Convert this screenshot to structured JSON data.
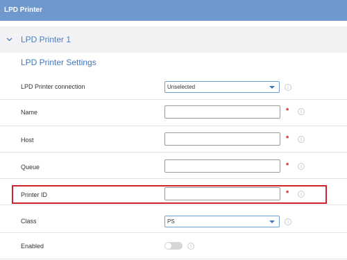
{
  "header": {
    "title": "LPD Printer"
  },
  "section": {
    "title": "LPD Printer 1",
    "subtitle": "LPD Printer Settings"
  },
  "fields": {
    "connection": {
      "label": "LPD Printer connection",
      "value": "Unselected"
    },
    "name": {
      "label": "Name",
      "value": "",
      "required": "*"
    },
    "host": {
      "label": "Host",
      "value": "",
      "required": "*"
    },
    "queue": {
      "label": "Queue",
      "value": "",
      "required": "*"
    },
    "printer_id": {
      "label": "Printer ID",
      "value": "",
      "required": "*"
    },
    "class": {
      "label": "Class",
      "value": "PS"
    },
    "enabled": {
      "label": "Enabled",
      "state": "off"
    }
  },
  "icons": {
    "info": "info-circle-icon",
    "chevron": "chevron-down-icon",
    "dropdown": "dropdown-arrow-icon"
  },
  "colors": {
    "header": "#6f99cd",
    "accent": "#3f77bd",
    "required": "#c0282d",
    "highlight": "#d0222b"
  },
  "glyphs": {
    "info": "i"
  }
}
